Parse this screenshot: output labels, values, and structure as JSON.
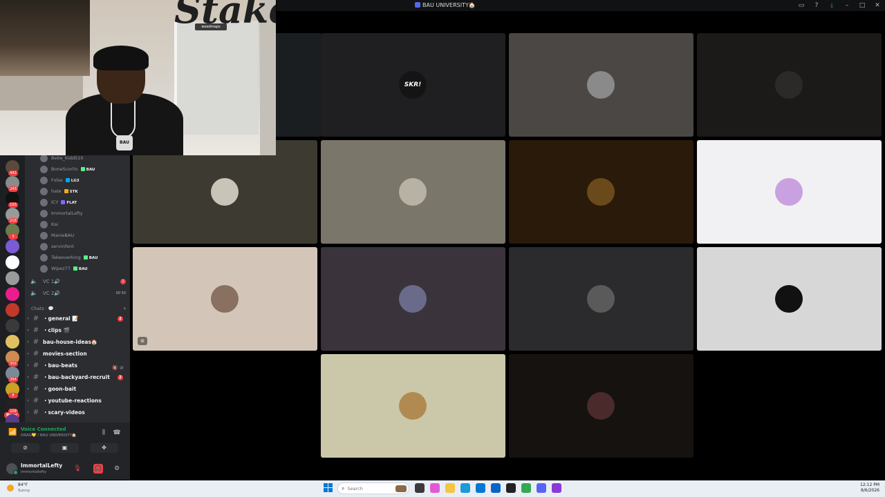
{
  "window": {
    "title": "BAU UNIVERSITY🏠",
    "controls": [
      "inbox-icon",
      "help-icon",
      "download-icon",
      "minimize-icon",
      "maximize-icon",
      "close-icon"
    ]
  },
  "webcam": {
    "logo_text": "Stake",
    "sponsor_text": "weedmaps",
    "shirt_print": "BAU"
  },
  "server_rail": {
    "servers": [
      {
        "badge": "442",
        "color": "#5b4a3a"
      },
      {
        "badge": "243",
        "color": "#8b8b8b"
      },
      {
        "badge": "193",
        "color": "#111111"
      },
      {
        "badge": "218",
        "color": "#9a9a9a"
      },
      {
        "badge": "9",
        "color": "#6b7a4a"
      },
      {
        "badge": "",
        "color": "#7b5ad6"
      },
      {
        "badge": "",
        "color": "#ffffff"
      },
      {
        "badge": "",
        "color": "#9a9a9a"
      },
      {
        "badge": "",
        "color": "#e91e8c"
      },
      {
        "badge": "",
        "color": "#c0392b"
      },
      {
        "badge": "",
        "color": "#3a3a3a"
      },
      {
        "badge": "",
        "color": "#e0c060"
      },
      {
        "badge": "302",
        "color": "#d08a50"
      },
      {
        "badge": "394",
        "color": "#7b8a9a"
      },
      {
        "badge": "8",
        "color": "#c9a227"
      },
      {
        "badge": "109",
        "color": "#222222"
      },
      {
        "badge": "143",
        "color": "#5a3a8a"
      }
    ],
    "new_label": "NEW"
  },
  "voice_users": [
    {
      "name": "Bebe_Kidd510",
      "tag": "",
      "tag_color": ""
    },
    {
      "name": "BoneScorlin",
      "tag": "BAU",
      "tag_color": "#57f287"
    },
    {
      "name": "Fxlse",
      "tag": "LG3",
      "tag_color": "#00a8fc"
    },
    {
      "name": "hate",
      "tag": "STK",
      "tag_color": "#faa61a"
    },
    {
      "name": "ICY",
      "tag": "FLAT",
      "tag_color": "#7b6cff"
    },
    {
      "name": "ImmortalLefty",
      "tag": "",
      "tag_color": ""
    },
    {
      "name": "Kai",
      "tag": "",
      "tag_color": ""
    },
    {
      "name": "ManieBAU",
      "tag": "",
      "tag_color": ""
    },
    {
      "name": "servinfent",
      "tag": "",
      "tag_color": ""
    },
    {
      "name": "Takeoverking",
      "tag": "BAU",
      "tag_color": "#57f287"
    },
    {
      "name": "Wipez77",
      "tag": "BAU",
      "tag_color": "#57f287"
    }
  ],
  "voice_channels": [
    {
      "name": "VC 1🔊",
      "right": "1",
      "type": "badge"
    },
    {
      "name": "VC 2🔊",
      "right": "00  50",
      "type": "count"
    }
  ],
  "category": {
    "label": "Chats ·  💬  ·"
  },
  "text_channels": [
    {
      "name": "・general 📝",
      "badge": "2"
    },
    {
      "name": "・clips 🎬",
      "badge": ""
    },
    {
      "name": "bau-house-ideas🏠",
      "badge": ""
    },
    {
      "name": "movies-section",
      "badge": ""
    },
    {
      "name": "・bau-beats",
      "badge": ""
    },
    {
      "name": "・bau-backyard-recruit",
      "badge": "2"
    },
    {
      "name": "・goon-bait",
      "badge": ""
    },
    {
      "name": "・youtube-reactions",
      "badge": ""
    },
    {
      "name": "・scary-videos",
      "badge": ""
    }
  ],
  "voice_panel": {
    "title": "Voice Connected",
    "subtitle": "DRAG💛 / BAU UNIVERSITY🏠"
  },
  "user_panel": {
    "username": "ImmortalLefty",
    "tag": "immortallefty"
  },
  "tiles": [
    {
      "avatar": "SKR!",
      "bg": "#1f1f22",
      "av_color": "#141414"
    },
    {
      "avatar": "",
      "bg": "#4a4744",
      "av_color": "#8a8a8a"
    },
    {
      "avatar": "",
      "bg": "#1b1a18",
      "av_color": "#2c2a28"
    },
    {
      "avatar": "",
      "bg": "#3d3a31",
      "av_color": "#c9c4b8"
    },
    {
      "avatar": "",
      "bg": "#7b766a",
      "av_color": "#b8b2a4"
    },
    {
      "avatar": "",
      "bg": "#2a1a0a",
      "av_color": "#6a4a1a"
    },
    {
      "avatar": "",
      "bg": "#f1f0f2",
      "av_color": "#c9a0e0"
    },
    {
      "avatar": "",
      "bg": "#d3c6b8",
      "av_color": "#8a7060"
    },
    {
      "avatar": "",
      "bg": "#3b333c",
      "av_color": "#6a6a8a"
    },
    {
      "avatar": "",
      "bg": "#2b2b2d",
      "av_color": "#5a5a5a"
    },
    {
      "avatar": "",
      "bg": "#d7d7d7",
      "av_color": "#111111"
    },
    {
      "avatar": "",
      "bg": "#cbc8a9",
      "av_color": "#b08a50"
    },
    {
      "avatar": "",
      "bg": "#16120f",
      "av_color": "#4a2a2a"
    },
    {
      "avatar": "",
      "bg": "#1a1e20",
      "av_color": ""
    }
  ],
  "taskbar": {
    "weather_temp": "84°F",
    "weather_desc": "Sunny",
    "search_placeholder": "Search",
    "apps": [
      {
        "name": "file-explorer",
        "color": "#3a3a3a"
      },
      {
        "name": "copilot",
        "color": "#e05ad6"
      },
      {
        "name": "folder",
        "color": "#f5c542"
      },
      {
        "name": "edge",
        "color": "#1a9ad6"
      },
      {
        "name": "store",
        "color": "#0078d4"
      },
      {
        "name": "outlook",
        "color": "#0a64c8"
      },
      {
        "name": "github",
        "color": "#222222"
      },
      {
        "name": "chrome",
        "color": "#34a853"
      },
      {
        "name": "discord",
        "color": "#5865f2"
      },
      {
        "name": "app-purple",
        "color": "#8a3ad6"
      }
    ],
    "time": "12:12 PM",
    "date": "8/6/2026"
  }
}
